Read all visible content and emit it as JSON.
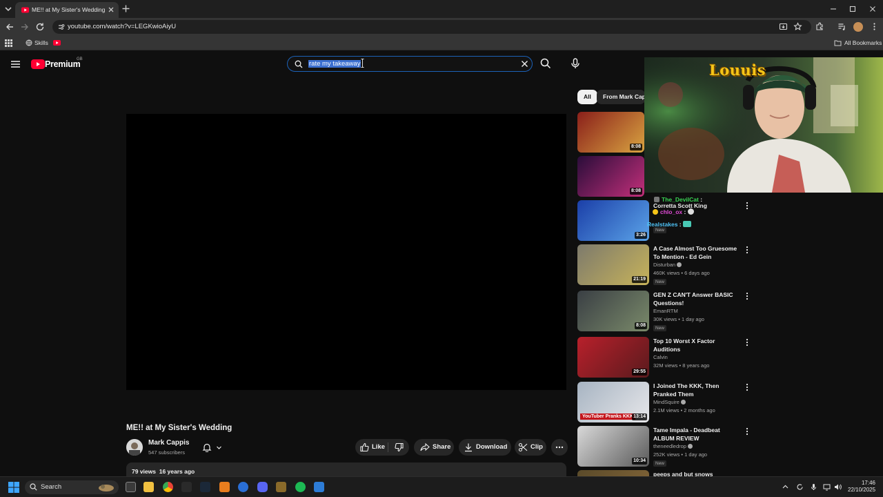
{
  "browser": {
    "tab_title": "ME!! at My Sister's Wedding - YouTube",
    "url": "youtube.com/watch?v=LEGKwioAiyU",
    "bookmarks": [
      "Skills"
    ],
    "all_bookmarks": "All Bookmarks"
  },
  "masthead": {
    "brand": "Premium",
    "country_code": "GB",
    "search_query": "rate my takeaway"
  },
  "video": {
    "title": "ME!! at My Sister's Wedding",
    "channel": "Mark Cappis",
    "subscribers": "547 subscribers",
    "views": "79 views",
    "age": "16 years ago",
    "actions": {
      "like": "Like",
      "share": "Share",
      "download": "Download",
      "clip": "Clip"
    }
  },
  "chips": {
    "all": "All",
    "from": "From Mark Cappis"
  },
  "recommendations": [
    {
      "title": "",
      "channel": "",
      "meta": "",
      "duration": "8:08",
      "badge": "",
      "thumb_colors": [
        "#8a1f1a",
        "#d9a441"
      ]
    },
    {
      "title": "",
      "channel": "",
      "meta": "",
      "duration": "8:08",
      "badge": "",
      "thumb_colors": [
        "#2a0d3a",
        "#c22f7a"
      ]
    },
    {
      "title": "Corretta Scott King",
      "channel": "",
      "meta": "",
      "duration": "3:26",
      "badge": "New",
      "thumb_colors": [
        "#1b3fa8",
        "#5ba3e8"
      ]
    },
    {
      "title": "A Case Almost Too Gruesome To Mention - Ed Gein",
      "channel": "Disturban",
      "meta": "460K views • 6 days ago",
      "duration": "21:19",
      "badge": "New",
      "thumb_colors": [
        "#7d7a6c",
        "#c7b35a"
      ]
    },
    {
      "title": "GEN Z CAN'T Answer BASIC Questions!",
      "channel": "EmanRTM",
      "meta": "30K views • 1 day ago",
      "duration": "8:08",
      "badge": "New",
      "thumb_colors": [
        "#3a3f44",
        "#7a8a6a"
      ]
    },
    {
      "title": "Top 10 Worst X Factor Auditions",
      "channel": "Calvin",
      "meta": "32M views • 8 years ago",
      "duration": "29:55",
      "badge": "",
      "thumb_colors": [
        "#b8202b",
        "#5a1a1d"
      ]
    },
    {
      "title": "I Joined The KKK, Then Pranked Them",
      "channel": "MindSquire",
      "meta": "2.1M views • 2 months ago",
      "duration": "13:14",
      "badge": "",
      "overlay": "YouTuber Pranks KKK",
      "thumb_colors": [
        "#a7b4c2",
        "#e7e7ea"
      ]
    },
    {
      "title": "Tame Impala - Deadbeat ALBUM REVIEW",
      "channel": "theneedledrop",
      "meta": "252K views • 1 day ago",
      "duration": "10:34",
      "badge": "New",
      "thumb_colors": [
        "#d9d9d9",
        "#5a5a5a"
      ]
    },
    {
      "title": "peeps and but snows",
      "channel": "",
      "meta": "",
      "duration": "",
      "badge": "",
      "thumb_colors": [
        "#5a4a2a",
        "#8a6a3a"
      ]
    }
  ],
  "webcam": {
    "label": "Louuis"
  },
  "chat": [
    {
      "user": "The_DevilCat",
      "text": "",
      "color": "#39d353"
    },
    {
      "user": "chlo_ox",
      "text": "",
      "color": "#e14bd6"
    },
    {
      "user": "Realstakes",
      "text": "",
      "color": "#4fc3f7"
    }
  ],
  "taskbar": {
    "search": "Search",
    "time": "17:46",
    "date": "22/10/2025"
  }
}
